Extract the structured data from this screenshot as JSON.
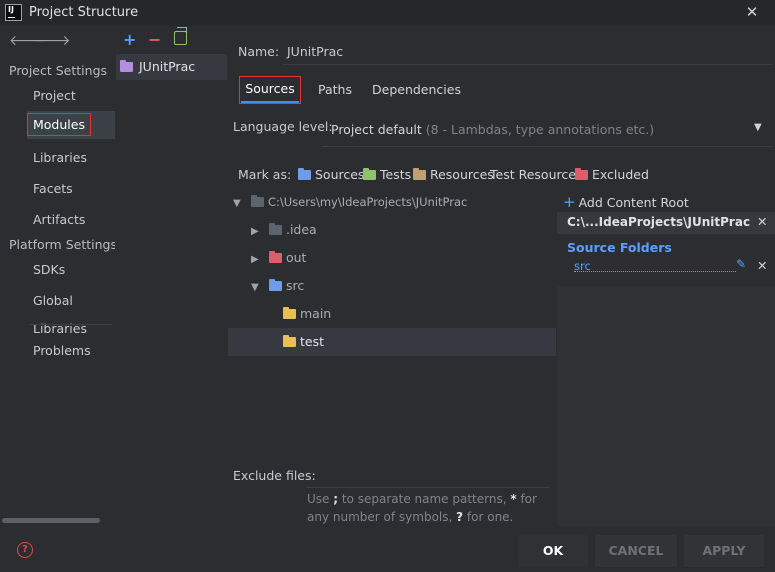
{
  "window": {
    "title": "Project Structure"
  },
  "sidebar": {
    "project_settings_header": "Project Settings",
    "platform_settings_header": "Platform Settings",
    "items": [
      "Project",
      "Modules",
      "Libraries",
      "Facets",
      "Artifacts"
    ],
    "platform_items": [
      "SDKs",
      "Global Libraries"
    ],
    "problems": "Problems",
    "selected": "Modules"
  },
  "modules": {
    "items": [
      {
        "label": "JUnitPrac"
      }
    ]
  },
  "main": {
    "name_label": "Name:",
    "name_value": "JUnitPrac",
    "tabs": [
      {
        "label": "Sources"
      },
      {
        "label": "Paths"
      },
      {
        "label": "Dependencies"
      }
    ],
    "language_level_label": "Language level:",
    "language_level_value": "Project default",
    "language_level_hint": "(8 - Lambdas, type annotations etc.)",
    "mark_as_label": "Mark as:",
    "mark_as": [
      "Sources",
      "Tests",
      "Resources",
      "Test Resources",
      "Excluded"
    ],
    "tree": {
      "root": "C:\\Users\\my\\IdeaProjects\\JUnitPrac",
      "idea": ".idea",
      "out": "out",
      "src": "src",
      "main": "main",
      "test": "test"
    },
    "exclude_label": "Exclude files:",
    "exclude_hint": {
      "p1": "Use ",
      "semicolon": ";",
      "p2": " to separate name patterns, ",
      "star": "*",
      "p3": " for any number of symbols, ",
      "q": "?",
      "p4": " for one."
    }
  },
  "content_root": {
    "add_label": "Add Content Root",
    "path": "C:\\...IdeaProjects\\JUnitPrac",
    "source_folders_title": "Source Folders",
    "source_folder": "src"
  },
  "buttons": {
    "ok": "OK",
    "cancel": "CANCEL",
    "apply": "APPLY"
  },
  "colors": {
    "accent": "#3d8bfd",
    "highlight_border": "#e0343a",
    "sources_folder": "#6f9be8",
    "tests_folder": "#8fc36b",
    "resources_folder": "#c0a070",
    "excluded_folder": "#e05c6a",
    "plain_folder": "#5d6470",
    "source_text": "#5aa0ff"
  }
}
